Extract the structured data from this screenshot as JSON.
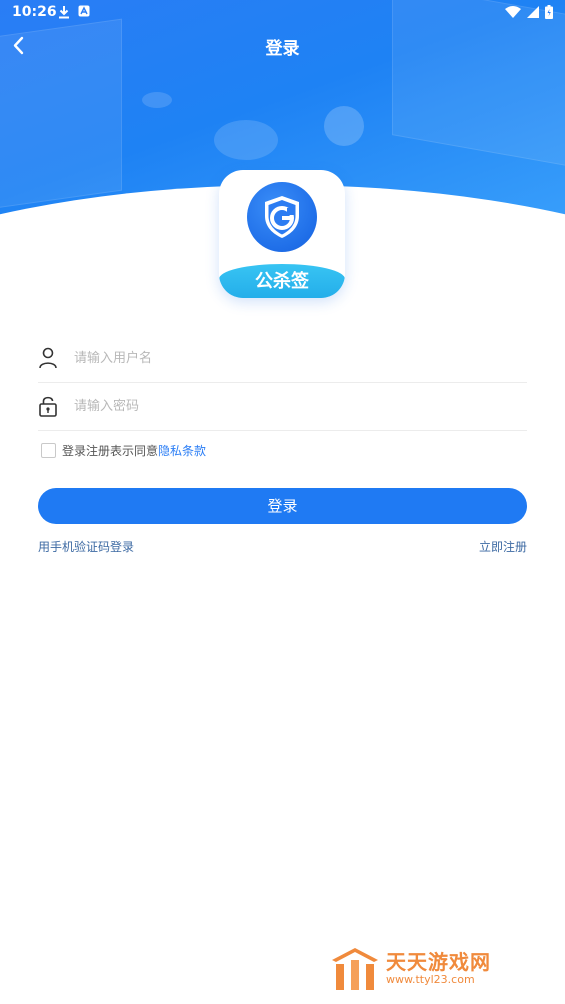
{
  "status_bar": {
    "time": "10:26"
  },
  "header": {
    "title": "登录"
  },
  "logo": {
    "brand_text": "公杀签"
  },
  "form": {
    "username_placeholder": "请输入用户名",
    "password_placeholder": "请输入密码",
    "agree_text": "登录注册表示同意",
    "privacy_link": "隐私条款"
  },
  "login_button_label": "登录",
  "links": {
    "phone_login": "用手机验证码登录",
    "register": "立即注册"
  },
  "watermark": {
    "name": "天天游戏网",
    "url": "www.ttyl23.com"
  },
  "colors": {
    "accent": "#1f7af3",
    "header_gradient_start": "#2a7df5",
    "header_gradient_end": "#3aa0fb",
    "logo_band": "#24aeea",
    "watermark": "#f08a3c"
  }
}
